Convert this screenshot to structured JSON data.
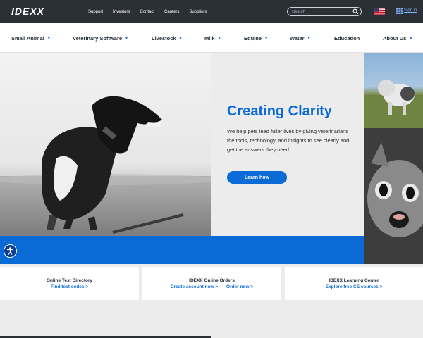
{
  "header": {
    "logo": "IDEXX",
    "links": [
      "Support",
      "Investors",
      "Contact",
      "Careers",
      "Suppliers"
    ],
    "search_placeholder": "Search",
    "signin": "Sign in"
  },
  "nav": {
    "items": [
      {
        "label": "Small Animal",
        "dropdown": true
      },
      {
        "label": "Veterinary Software",
        "dropdown": true
      },
      {
        "label": "Livestock",
        "dropdown": true
      },
      {
        "label": "Milk",
        "dropdown": true
      },
      {
        "label": "Equine",
        "dropdown": true
      },
      {
        "label": "Water",
        "dropdown": true
      },
      {
        "label": "Education",
        "dropdown": false
      },
      {
        "label": "About Us",
        "dropdown": true
      }
    ]
  },
  "hero": {
    "title": "Creating Clarity",
    "text": "We help pets lead fuller lives by giving veterinarians the tools, technology, and insights to see clearly and get the answers they need.",
    "button": "Learn how"
  },
  "cards": [
    {
      "title": "Online Test Directory",
      "links": [
        "Find test codes >"
      ]
    },
    {
      "title": "IDEXX Online Orders",
      "links": [
        "Create account now >",
        "Order now >"
      ]
    },
    {
      "title": "IDEXX Learning Center",
      "links": [
        "Explore free CE courses >"
      ]
    }
  ],
  "colors": {
    "brand_blue": "#0b6bd6",
    "topbar": "#2b2f36"
  }
}
